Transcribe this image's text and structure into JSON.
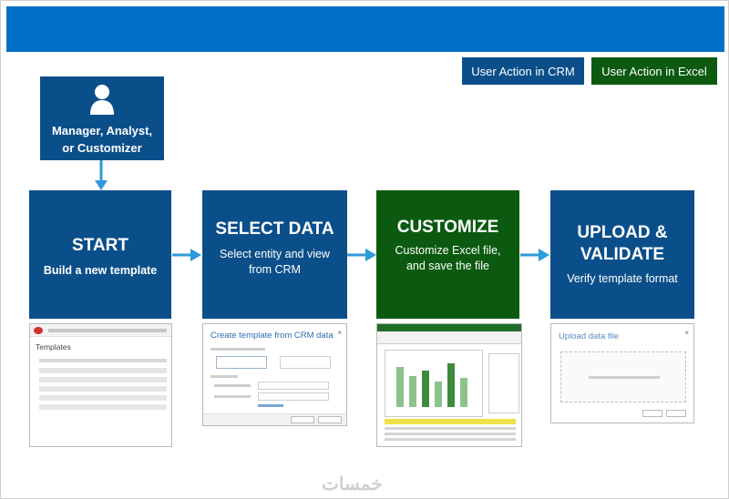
{
  "legend": {
    "crm": "User Action in CRM",
    "excel": "User Action in Excel"
  },
  "actor": {
    "lines": [
      "Manager, Analyst,",
      "or Customizer"
    ]
  },
  "steps": [
    {
      "title": [
        "START"
      ],
      "subtitle": [
        "Build a new template"
      ],
      "color": "#0b4f8a"
    },
    {
      "title": [
        "SELECT DATA"
      ],
      "subtitle": [
        "Select entity and view",
        "from CRM"
      ],
      "color": "#0b4f8a"
    },
    {
      "title": [
        "CUSTOMIZE"
      ],
      "subtitle": [
        "Customize Excel file,",
        "and save the file"
      ],
      "color": "#0b5a10"
    },
    {
      "title": [
        "UPLOAD &",
        "VALIDATE"
      ],
      "subtitle": [
        "Verify template format"
      ],
      "color": "#0b4f8a"
    }
  ],
  "thumbs": {
    "templates": {
      "header": "Templates"
    },
    "select": {
      "header": "Create template from CRM data"
    },
    "upload": {
      "header": "Upload data file"
    }
  },
  "watermark": "خمسات"
}
